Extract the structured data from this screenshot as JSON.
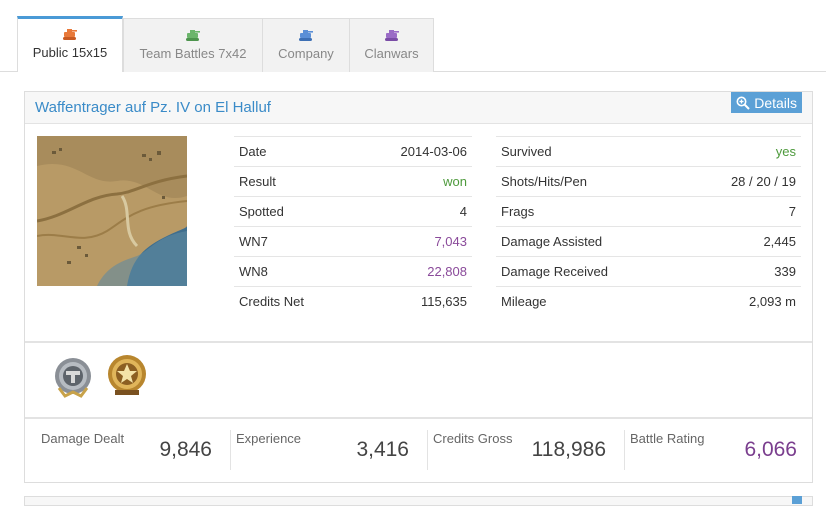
{
  "tabs": [
    {
      "label": "Public 15x15",
      "icon": "tank-icon",
      "color": "#e8793a",
      "active": true
    },
    {
      "label": "Team Battles 7x42",
      "icon": "tank-icon",
      "color": "#6bb56b",
      "active": false
    },
    {
      "label": "Company",
      "icon": "tank-icon",
      "color": "#5b8fd6",
      "active": false
    },
    {
      "label": "Clanwars",
      "icon": "tank-icon",
      "color": "#9a6bc6",
      "active": false
    }
  ],
  "battle": {
    "title": "Waffentrager auf Pz. IV on El Halluf",
    "details_label": "Details",
    "left_stats": [
      {
        "label": "Date",
        "value": "2014-03-06"
      },
      {
        "label": "Result",
        "value": "won"
      },
      {
        "label": "Spotted",
        "value": "4"
      },
      {
        "label": "WN7",
        "value": "7,043"
      },
      {
        "label": "WN8",
        "value": "22,808"
      },
      {
        "label": "Credits Net",
        "value": "115,635"
      }
    ],
    "right_stats": [
      {
        "label": "Survived",
        "value": "yes"
      },
      {
        "label": "Shots/Hits/Pen",
        "value": "28 / 20 / 19"
      },
      {
        "label": "Frags",
        "value": "7"
      },
      {
        "label": "Damage Assisted",
        "value": "2,445"
      },
      {
        "label": "Damage Received",
        "value": "339"
      },
      {
        "label": "Mileage",
        "value": "2,093 m"
      }
    ],
    "medals": [
      "ace-tanker-medal-icon",
      "star-medal-icon"
    ],
    "summary": [
      {
        "label": "Damage Dealt",
        "value": "9,846"
      },
      {
        "label": "Experience",
        "value": "3,416"
      },
      {
        "label": "Credits Gross",
        "value": "118,986"
      },
      {
        "label": "Battle Rating",
        "value": "6,066"
      }
    ]
  },
  "colors": {
    "accent": "#4a9ad6",
    "positive": "#4d9a3c",
    "rating": "#8a4a9a"
  }
}
